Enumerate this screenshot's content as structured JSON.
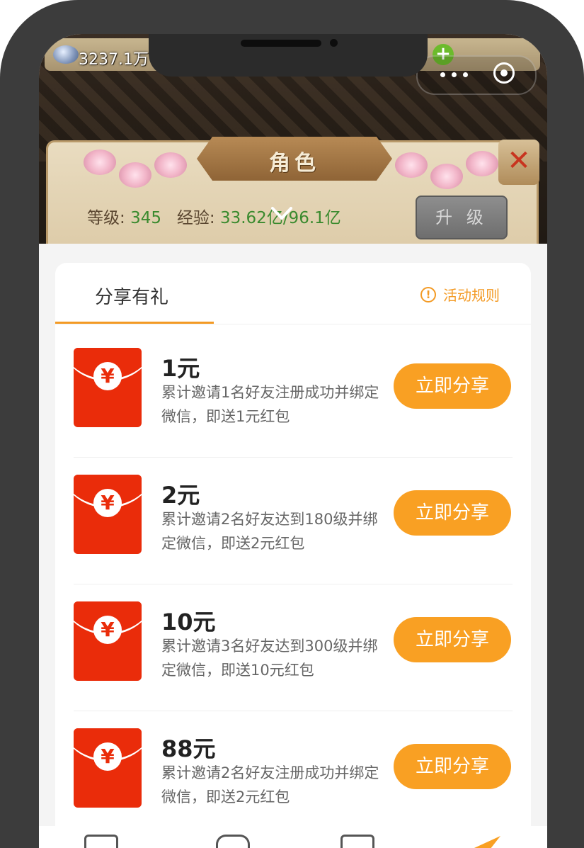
{
  "game": {
    "currency": "3237.1万",
    "panel_title": "角色",
    "level_label": "等级:",
    "level_value": "345",
    "exp_label": "经验:",
    "exp_value": "33.62亿/96.1亿",
    "upgrade_label": "升 级",
    "close_label": "✕"
  },
  "sheet": {
    "tab_label": "分享有礼",
    "rules_label": "活动规则",
    "info_glyph": "!"
  },
  "rewards": [
    {
      "amount": "1元",
      "desc": "累计邀请1名好友注册成功并绑定微信，即送1元红包",
      "button": "立即分享"
    },
    {
      "amount": "2元",
      "desc": "累计邀请2名好友达到180级并绑定微信，即送2元红包",
      "button": "立即分享"
    },
    {
      "amount": "10元",
      "desc": "累计邀请3名好友达到300级并绑定微信，即送10元红包",
      "button": "立即分享"
    },
    {
      "amount": "88元",
      "desc": "累计邀请2名好友注册成功并绑定微信，即送2元红包",
      "button": "立即分享"
    }
  ],
  "envelope_symbol": "¥",
  "colors": {
    "accent": "#f9a023",
    "envelope": "#ea2c0a",
    "level_green": "#3a8a2e"
  }
}
